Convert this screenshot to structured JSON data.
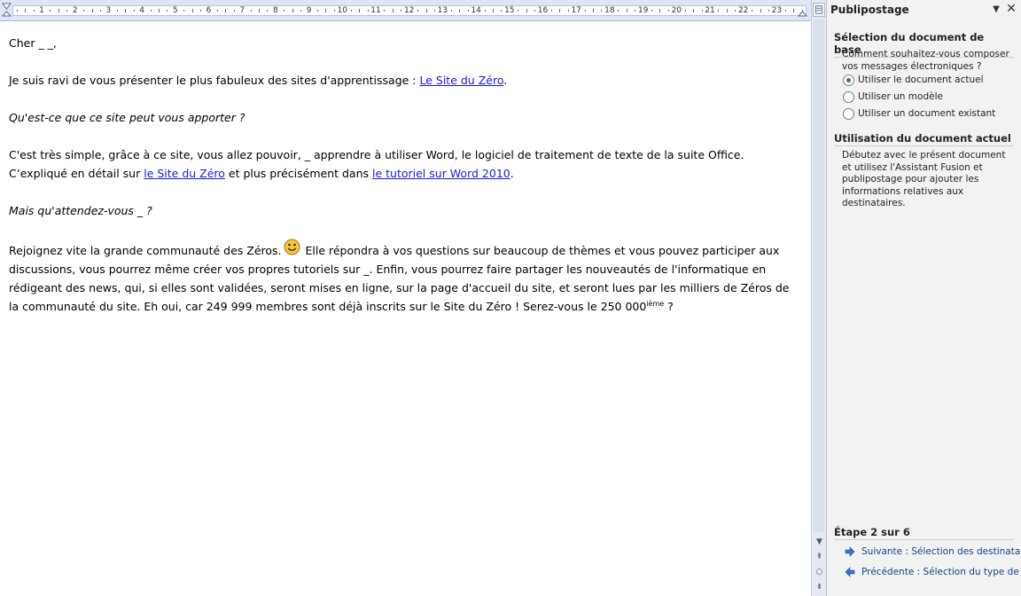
{
  "ruler": {
    "numbers": [
      "1",
      "2",
      "3",
      "4",
      "5",
      "6",
      "7",
      "8",
      "9",
      "10",
      "11",
      "12",
      "13",
      "14",
      "15",
      "16",
      "17",
      "18",
      "19",
      "20",
      "21",
      "22",
      "23"
    ]
  },
  "document": {
    "greeting": "Cher _ _,",
    "p1_text": "Je suis ravi de vous présenter le plus fabuleux des sites d'apprentissage : ",
    "p1_link": "Le Site du Zéro",
    "p1_end": ".",
    "q1": "Qu'est-ce que ce site peut vous apporter ?",
    "p2_text_a": "C'est très simple, grâce à ce site, vous allez pouvoir, _ apprendre à utiliser Word, le logiciel de traitement de texte de la suite Office.  C’expliqué en détail sur ",
    "p2_link1": "le Site du Zéro",
    "p2_text_b": " et plus précisément dans ",
    "p2_link2": "le tutoriel sur Word 2010",
    "p2_end": ".",
    "q2": "Mais qu'attendez-vous _ ?",
    "p3_text_a": "Rejoignez vite la grande communauté des Zéros.",
    "p3_text_b": " Elle répondra à vos questions sur beaucoup de thèmes et vous pouvez participer aux discussions, vous pourrez même créer vos propres tutoriels sur _. Enfin, vous pourrez faire partager les nouveautés de l'informatique en rédigeant des news, qui, si elles sont validées, seront mises en ligne, sur la page d'accueil du site, et seront lues par les milliers de Zéros de la communauté du site. Eh oui, car 249 999 membres sont déjà inscrits sur le Site du Zéro ! Serez-vous le 250 000",
    "p3_sup": "ième",
    "p3_end": " ?"
  },
  "pane": {
    "title": "Publipostage",
    "section1_title": "Sélection du document de base",
    "section1_question": "Comment souhaitez-vous composer vos messages électroniques ?",
    "options": [
      {
        "label": "Utiliser le document actuel",
        "checked": true
      },
      {
        "label": "Utiliser un modèle",
        "checked": false
      },
      {
        "label": "Utiliser un document existant",
        "checked": false
      }
    ],
    "section2_title": "Utilisation du document actuel",
    "section2_body": "Débutez avec le présent document et utilisez l'Assistant Fusion et publipostage pour ajouter les informations relatives aux destinataires.",
    "step_label": "Étape 2 sur 6",
    "next_link": "Suivante : Sélection des destinataires",
    "prev_link": "Précédente : Sélection du type de document"
  },
  "colors": {
    "link": "#1a1ae6",
    "pane_link": "#15428b",
    "radio_checked": "#2a8a2a"
  }
}
